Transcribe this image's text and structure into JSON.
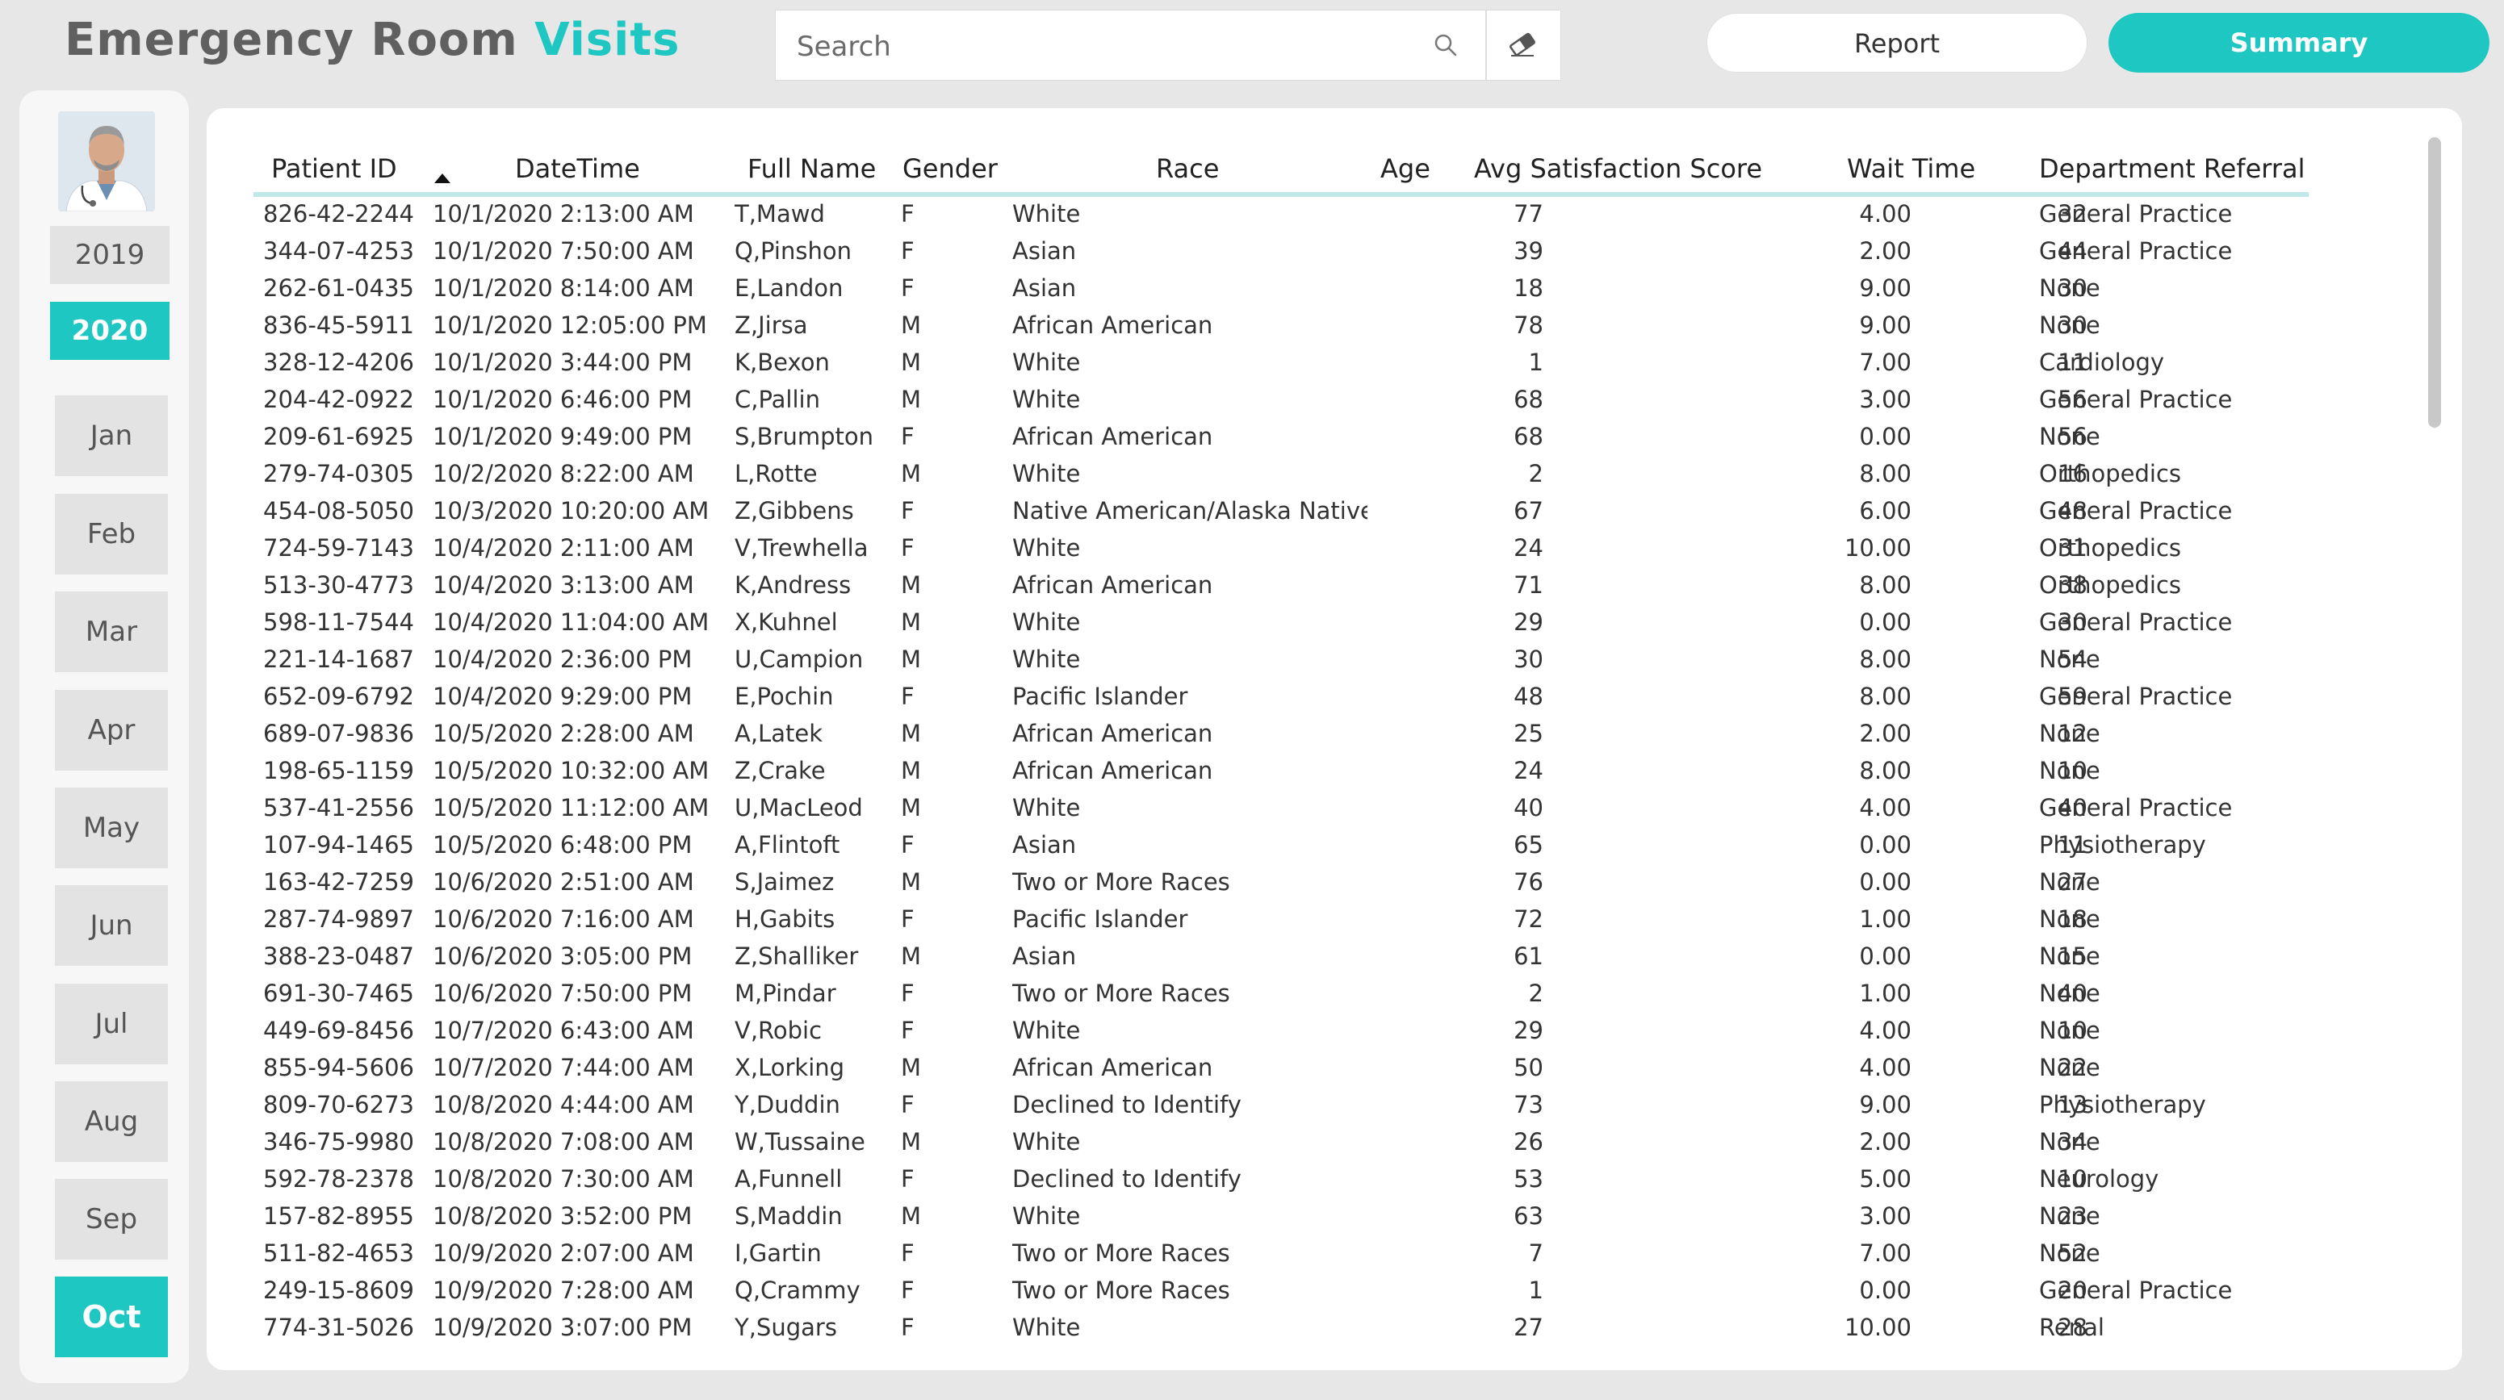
{
  "header": {
    "title_part1": "Emergency Room",
    "title_part2": "Visits",
    "search_placeholder": "Search",
    "report_label": "Report",
    "summary_label": "Summary"
  },
  "sidebar": {
    "years": [
      {
        "label": "2019",
        "selected": false
      },
      {
        "label": "2020",
        "selected": true
      }
    ],
    "months": [
      {
        "label": "Jan",
        "selected": false
      },
      {
        "label": "Feb",
        "selected": false
      },
      {
        "label": "Mar",
        "selected": false
      },
      {
        "label": "Apr",
        "selected": false
      },
      {
        "label": "May",
        "selected": false
      },
      {
        "label": "Jun",
        "selected": false
      },
      {
        "label": "Jul",
        "selected": false
      },
      {
        "label": "Aug",
        "selected": false
      },
      {
        "label": "Sep",
        "selected": false
      },
      {
        "label": "Oct",
        "selected": true
      }
    ]
  },
  "table": {
    "columns": [
      "Patient ID",
      "DateTime",
      "Full Name",
      "Gender",
      "Race",
      "Age",
      "Avg Satisfaction Score",
      "Wait Time",
      "Department Referral"
    ],
    "sorted_column": "Patient ID",
    "rows": [
      [
        "826-42-2244",
        "10/1/2020 2:13:00 AM",
        "T,Mawd",
        "F",
        "White",
        "77",
        "4.00",
        "32",
        "General Practice"
      ],
      [
        "344-07-4253",
        "10/1/2020 7:50:00 AM",
        "Q,Pinshon",
        "F",
        "Asian",
        "39",
        "2.00",
        "44",
        "General Practice"
      ],
      [
        "262-61-0435",
        "10/1/2020 8:14:00 AM",
        "E,Landon",
        "F",
        "Asian",
        "18",
        "9.00",
        "30",
        "None"
      ],
      [
        "836-45-5911",
        "10/1/2020 12:05:00 PM",
        "Z,Jirsa",
        "M",
        "African American",
        "78",
        "9.00",
        "30",
        "None"
      ],
      [
        "328-12-4206",
        "10/1/2020 3:44:00 PM",
        "K,Bexon",
        "M",
        "White",
        "1",
        "7.00",
        "11",
        "Cardiology"
      ],
      [
        "204-42-0922",
        "10/1/2020 6:46:00 PM",
        "C,Pallin",
        "M",
        "White",
        "68",
        "3.00",
        "56",
        "General Practice"
      ],
      [
        "209-61-6925",
        "10/1/2020 9:49:00 PM",
        "S,Brumpton",
        "F",
        "African American",
        "68",
        "0.00",
        "56",
        "None"
      ],
      [
        "279-74-0305",
        "10/2/2020 8:22:00 AM",
        "L,Rotte",
        "M",
        "White",
        "2",
        "8.00",
        "16",
        "Orthopedics"
      ],
      [
        "454-08-5050",
        "10/3/2020 10:20:00 AM",
        "Z,Gibbens",
        "F",
        "Native American/Alaska Native",
        "67",
        "6.00",
        "48",
        "General Practice"
      ],
      [
        "724-59-7143",
        "10/4/2020 2:11:00 AM",
        "V,Trewhella",
        "F",
        "White",
        "24",
        "10.00",
        "31",
        "Orthopedics"
      ],
      [
        "513-30-4773",
        "10/4/2020 3:13:00 AM",
        "K,Andress",
        "M",
        "African American",
        "71",
        "8.00",
        "38",
        "Orthopedics"
      ],
      [
        "598-11-7544",
        "10/4/2020 11:04:00 AM",
        "X,Kuhnel",
        "M",
        "White",
        "29",
        "0.00",
        "30",
        "General Practice"
      ],
      [
        "221-14-1687",
        "10/4/2020 2:36:00 PM",
        "U,Campion",
        "M",
        "White",
        "30",
        "8.00",
        "54",
        "None"
      ],
      [
        "652-09-6792",
        "10/4/2020 9:29:00 PM",
        "E,Pochin",
        "F",
        "Pacific Islander",
        "48",
        "8.00",
        "59",
        "General Practice"
      ],
      [
        "689-07-9836",
        "10/5/2020 2:28:00 AM",
        "A,Latek",
        "M",
        "African American",
        "25",
        "2.00",
        "12",
        "None"
      ],
      [
        "198-65-1159",
        "10/5/2020 10:32:00 AM",
        "Z,Crake",
        "M",
        "African American",
        "24",
        "8.00",
        "10",
        "None"
      ],
      [
        "537-41-2556",
        "10/5/2020 11:12:00 AM",
        "U,MacLeod",
        "M",
        "White",
        "40",
        "4.00",
        "40",
        "General Practice"
      ],
      [
        "107-94-1465",
        "10/5/2020 6:48:00 PM",
        "A,Flintoft",
        "F",
        "Asian",
        "65",
        "0.00",
        "11",
        "Physiotherapy"
      ],
      [
        "163-42-7259",
        "10/6/2020 2:51:00 AM",
        "S,Jaimez",
        "M",
        "Two or More Races",
        "76",
        "0.00",
        "27",
        "None"
      ],
      [
        "287-74-9897",
        "10/6/2020 7:16:00 AM",
        "H,Gabits",
        "F",
        "Pacific Islander",
        "72",
        "1.00",
        "18",
        "None"
      ],
      [
        "388-23-0487",
        "10/6/2020 3:05:00 PM",
        "Z,Shalliker",
        "M",
        "Asian",
        "61",
        "0.00",
        "15",
        "None"
      ],
      [
        "691-30-7465",
        "10/6/2020 7:50:00 PM",
        "M,Pindar",
        "F",
        "Two or More Races",
        "2",
        "1.00",
        "40",
        "None"
      ],
      [
        "449-69-8456",
        "10/7/2020 6:43:00 AM",
        "V,Robic",
        "F",
        "White",
        "29",
        "4.00",
        "10",
        "None"
      ],
      [
        "855-94-5606",
        "10/7/2020 7:44:00 AM",
        "X,Lorking",
        "M",
        "African American",
        "50",
        "4.00",
        "22",
        "None"
      ],
      [
        "809-70-6273",
        "10/8/2020 4:44:00 AM",
        "Y,Duddin",
        "F",
        "Declined to Identify",
        "73",
        "9.00",
        "13",
        "Physiotherapy"
      ],
      [
        "346-75-9980",
        "10/8/2020 7:08:00 AM",
        "W,Tussaine",
        "M",
        "White",
        "26",
        "2.00",
        "34",
        "None"
      ],
      [
        "592-78-2378",
        "10/8/2020 7:30:00 AM",
        "A,Funnell",
        "F",
        "Declined to Identify",
        "53",
        "5.00",
        "10",
        "Neurology"
      ],
      [
        "157-82-8955",
        "10/8/2020 3:52:00 PM",
        "S,Maddin",
        "M",
        "White",
        "63",
        "3.00",
        "23",
        "None"
      ],
      [
        "511-82-4653",
        "10/9/2020 2:07:00 AM",
        "I,Gartin",
        "F",
        "Two or More Races",
        "7",
        "7.00",
        "52",
        "None"
      ],
      [
        "249-15-8609",
        "10/9/2020 7:28:00 AM",
        "Q,Crammy",
        "F",
        "Two or More Races",
        "1",
        "0.00",
        "20",
        "General Practice"
      ],
      [
        "774-31-5026",
        "10/9/2020 3:07:00 PM",
        "Y,Sugars",
        "F",
        "White",
        "27",
        "10.00",
        "28",
        "Renal"
      ]
    ]
  },
  "colors": {
    "accent": "#1fc7c2",
    "header_rule": "#bfe9e8",
    "background": "#e7e7e7",
    "inactive_button": "#e3e3e3"
  },
  "icons": {
    "search": "search-icon",
    "clear": "eraser-icon",
    "sort": "sort-ascending-icon"
  }
}
